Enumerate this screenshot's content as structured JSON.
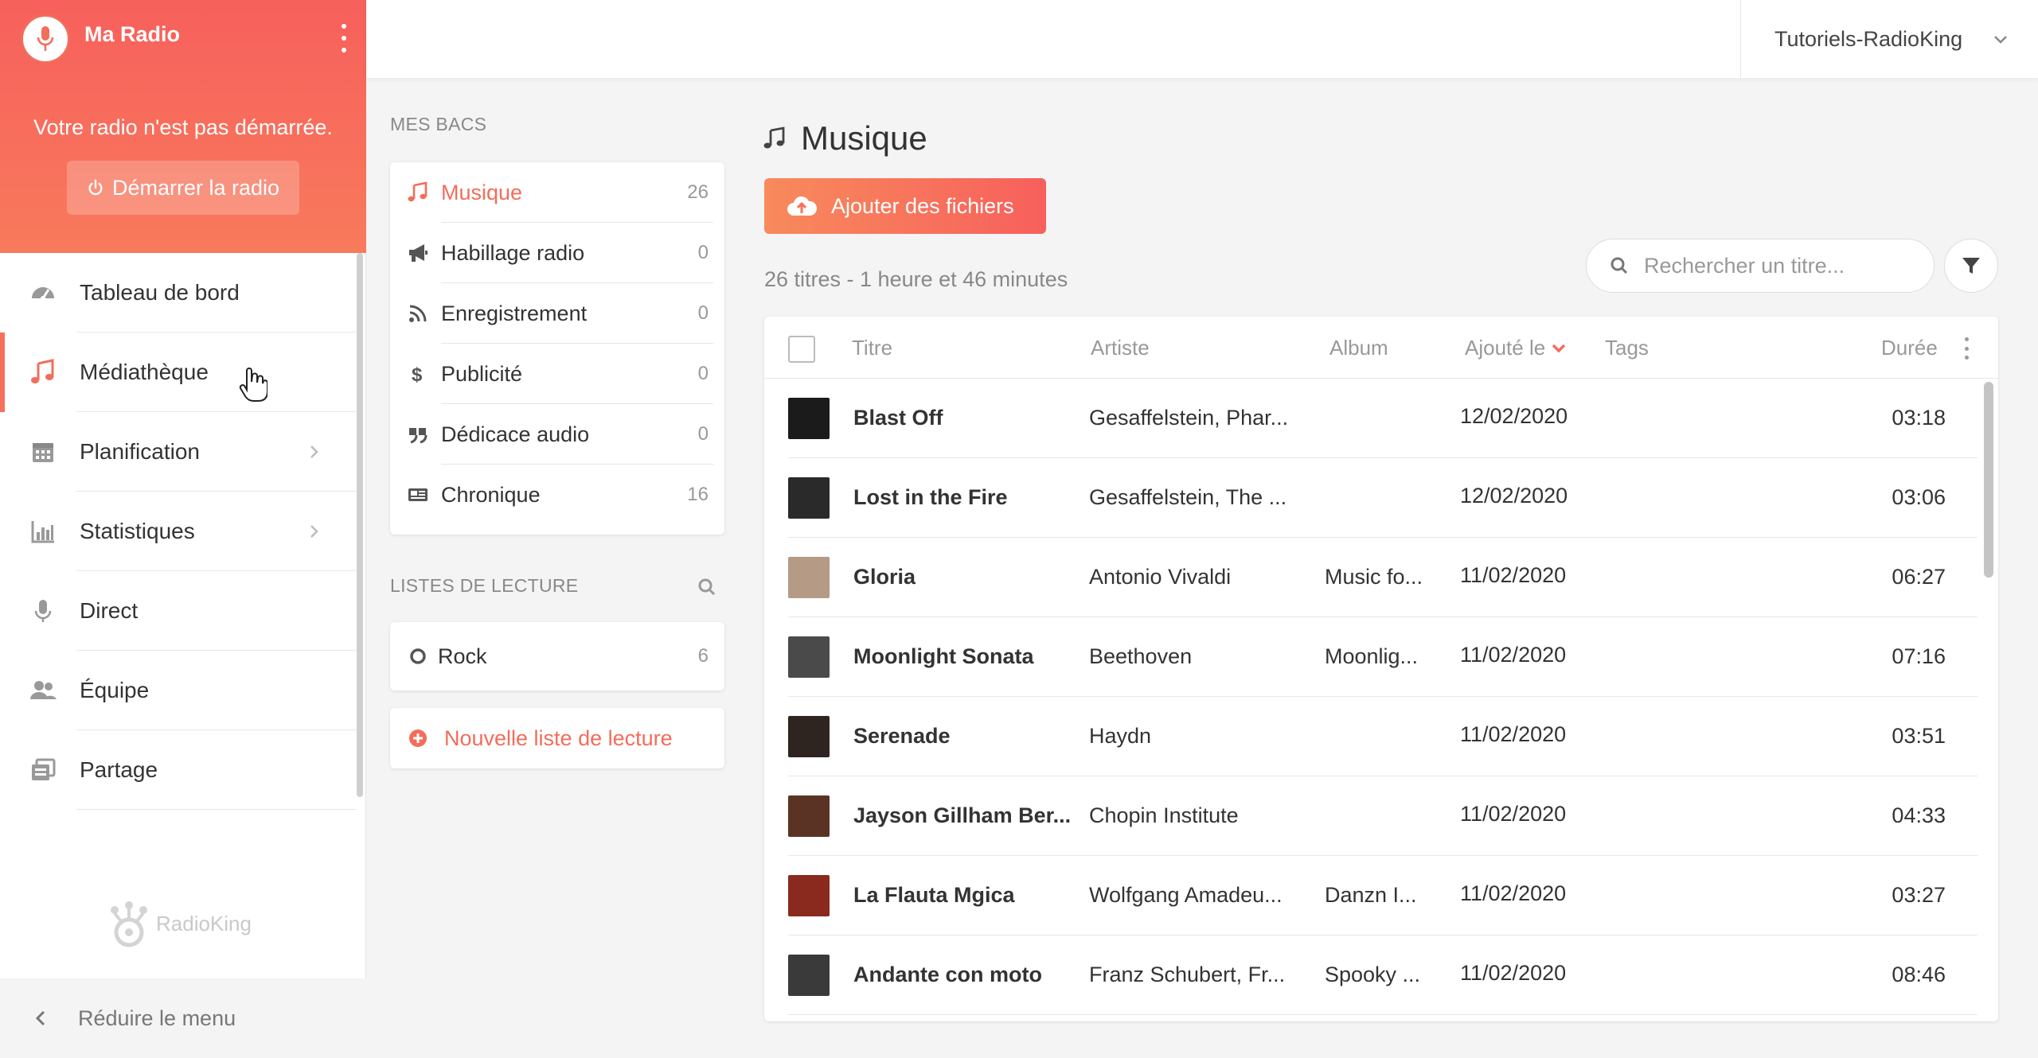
{
  "sidebar": {
    "brand_name": "Ma Radio",
    "status_text": "Votre radio n'est pas démarrée.",
    "start_button": "Démarrer la radio",
    "nav": [
      {
        "label": "Tableau de bord",
        "icon": "dashboard-icon"
      },
      {
        "label": "Médiathèque",
        "icon": "music-note-icon",
        "active": true
      },
      {
        "label": "Planification",
        "icon": "calendar-icon"
      },
      {
        "label": "Statistiques",
        "icon": "bar-chart-icon"
      },
      {
        "label": "Direct",
        "icon": "microphone-icon"
      },
      {
        "label": "Équipe",
        "icon": "users-icon"
      },
      {
        "label": "Partage",
        "icon": "share-icon"
      }
    ],
    "footer_logo": "RadioKing",
    "collapse_label": "Réduire le menu"
  },
  "header": {
    "account_name": "Tutoriels-RadioKing"
  },
  "bacs": {
    "title": "MES BACS",
    "items": [
      {
        "label": "Musique",
        "count": "26",
        "icon": "music-note-icon"
      },
      {
        "label": "Habillage radio",
        "count": "0",
        "icon": "megaphone-icon"
      },
      {
        "label": "Enregistrement",
        "count": "0",
        "icon": "rss-icon"
      },
      {
        "label": "Publicité",
        "count": "0",
        "icon": "dollar-icon"
      },
      {
        "label": "Dédicace audio",
        "count": "0",
        "icon": "quote-icon"
      },
      {
        "label": "Chronique",
        "count": "16",
        "icon": "newspaper-icon"
      }
    ]
  },
  "playlists": {
    "title": "LISTES DE LECTURE",
    "items": [
      {
        "label": "Rock",
        "count": "6"
      }
    ],
    "new_label": "Nouvelle liste de lecture"
  },
  "main": {
    "title": "Musique",
    "add_button": "Ajouter des fichiers",
    "summary": "26 titres - 1 heure et 46 minutes",
    "search_placeholder": "Rechercher un titre...",
    "columns": {
      "title": "Titre",
      "artist": "Artiste",
      "album": "Album",
      "added": "Ajouté le",
      "tags": "Tags",
      "duration": "Durée"
    },
    "rows": [
      {
        "title": "Blast Off",
        "artist": "Gesaffelstein, Phar...",
        "album": "",
        "date": "12/02/2020",
        "duration": "03:18",
        "thumb": "#1b1b1b"
      },
      {
        "title": "Lost in the Fire",
        "artist": "Gesaffelstein, The ...",
        "album": "",
        "date": "12/02/2020",
        "duration": "03:06",
        "thumb": "#2a2a2a"
      },
      {
        "title": "Gloria",
        "artist": "Antonio Vivaldi",
        "album": "Music fo...",
        "date": "11/02/2020",
        "duration": "06:27",
        "thumb": "#b59a86"
      },
      {
        "title": "Moonlight Sonata",
        "artist": "Beethoven",
        "album": "Moonlig...",
        "date": "11/02/2020",
        "duration": "07:16",
        "thumb": "#4a4a4a"
      },
      {
        "title": "Serenade",
        "artist": "Haydn",
        "album": "",
        "date": "11/02/2020",
        "duration": "03:51",
        "thumb": "#2e2420"
      },
      {
        "title": "Jayson Gillham Ber...",
        "artist": "Chopin Institute",
        "album": "",
        "date": "11/02/2020",
        "duration": "04:33",
        "thumb": "#5a3324"
      },
      {
        "title": "La Flauta Mgica",
        "artist": "Wolfgang Amadeu...",
        "album": "Danzn I...",
        "date": "11/02/2020",
        "duration": "03:27",
        "thumb": "#8a2a1e"
      },
      {
        "title": "Andante con moto",
        "artist": "Franz Schubert, Fr...",
        "album": "Spooky ...",
        "date": "11/02/2020",
        "duration": "08:46",
        "thumb": "#3a3a3a"
      }
    ]
  },
  "colors": {
    "accent": "#f36d5b",
    "brand_gradient_top": "#f7605c",
    "brand_gradient_bottom": "#f87a5c"
  }
}
